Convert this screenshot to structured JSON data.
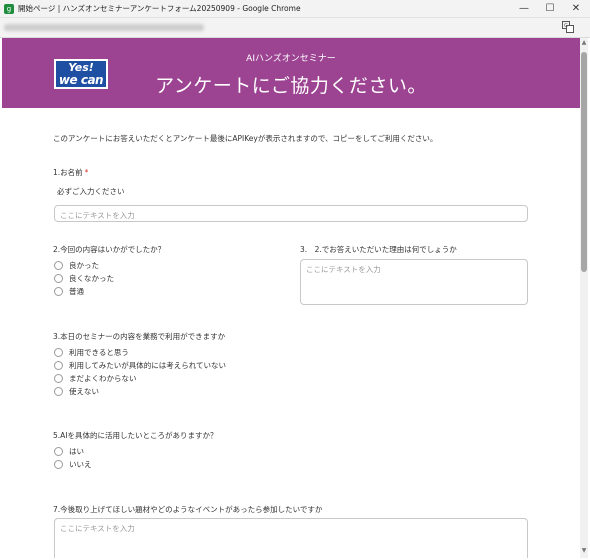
{
  "window": {
    "title": "開始ページ | ハンズオンセミナーアンケートフォーム20250909 - Google Chrome",
    "controls": {
      "minimize": "—",
      "maximize": "☐",
      "close": "✕"
    }
  },
  "hero": {
    "logo_line1": "Yes!",
    "logo_line2": "we can",
    "subtitle": "AIハンズオンセミナー",
    "title": "アンケートにご協力ください。",
    "bg_color": "#9c4392"
  },
  "intro": "このアンケートにお答えいただくとアンケート最後にAPIKeyが表示されますので、コピーをしてご利用ください。",
  "q1": {
    "label": "1.お名前",
    "required_mark": "*",
    "note": "必ずご入力ください",
    "placeholder": "ここにテキストを入力"
  },
  "q2": {
    "label": "2.今回の内容はいかがでしたか？",
    "options": [
      "良かった",
      "良くなかった",
      "普通"
    ]
  },
  "q3reason": {
    "label": "3.　2.でお答えいただいた理由は何でしょうか",
    "placeholder": "ここにテキストを入力"
  },
  "q3": {
    "label": "3.本日のセミナーの内容を業務で利用ができますか",
    "options": [
      "利用できると思う",
      "利用してみたいが具体的には考えられていない",
      "まだよくわからない",
      "使えない"
    ]
  },
  "q5": {
    "label": "5.AIを具体的に活用したいところがありますか？",
    "options": [
      "はい",
      "いいえ"
    ]
  },
  "q7": {
    "label": "7.今後取り上げてほしい題材やどのようなイベントがあったら参加したいですか",
    "placeholder": "ここにテキストを入力"
  },
  "icons": {
    "app": "chrome-app-icon",
    "translate": "translate-icon",
    "scroll_up": "scroll-up-arrow",
    "scroll_down": "scroll-down-arrow"
  }
}
